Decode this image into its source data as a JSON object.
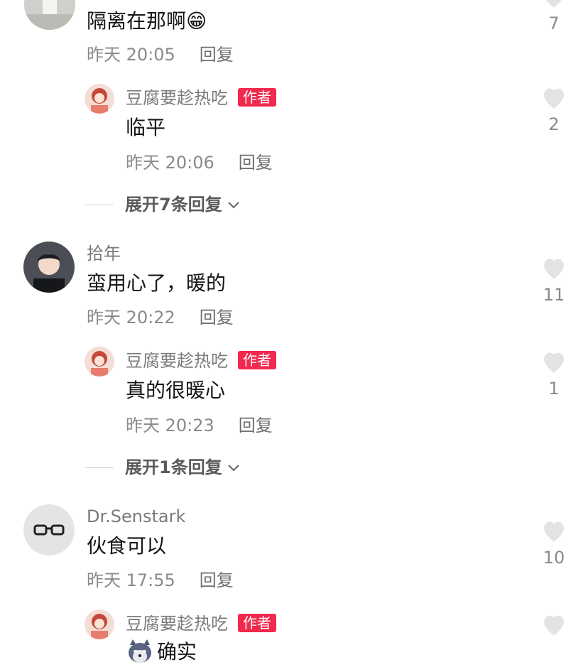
{
  "comments": [
    {
      "text": "隔离在那啊😁",
      "time": "昨天 20:05",
      "reply": "回复",
      "likes": "7",
      "author_reply": {
        "user": "豆腐要趁热吃",
        "badge": "作者",
        "text": "临平",
        "time": "昨天 20:06",
        "reply": "回复",
        "likes": "2"
      },
      "expand": "展开7条回复"
    },
    {
      "user": "拾年",
      "text": "蛮用心了，暖的",
      "time": "昨天 20:22",
      "reply": "回复",
      "likes": "11",
      "author_reply": {
        "user": "豆腐要趁热吃",
        "badge": "作者",
        "text": "真的很暖心",
        "time": "昨天 20:23",
        "reply": "回复",
        "likes": "1"
      },
      "expand": "展开1条回复"
    },
    {
      "user": "Dr.Senstark",
      "text": "伙食可以",
      "time": "昨天 17:55",
      "reply": "回复",
      "likes": "10",
      "author_reply": {
        "user": "豆腐要趁热吃",
        "badge": "作者",
        "text": "确实",
        "emoji": "doge-icon"
      }
    }
  ],
  "colors": {
    "badge": "#f0294d",
    "meta": "#8a8a8a",
    "heart": "#e3e3e3"
  }
}
